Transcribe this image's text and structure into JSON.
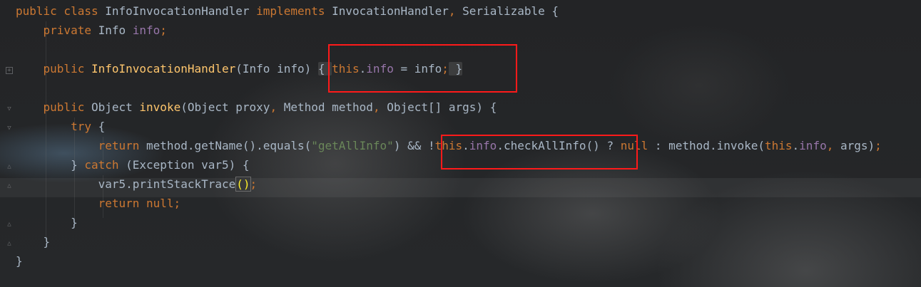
{
  "editor": {
    "lines": [
      {
        "tokens": [
          {
            "t": "public class ",
            "c": "kw"
          },
          {
            "t": "InfoInvocationHandler ",
            "c": "pl"
          },
          {
            "t": "implements ",
            "c": "kw"
          },
          {
            "t": "InvocationHandler",
            "c": "pl"
          },
          {
            "t": ", ",
            "c": "kw"
          },
          {
            "t": "Serializable {",
            "c": "pl"
          }
        ]
      },
      {
        "tokens": [
          {
            "t": "    private ",
            "c": "kw"
          },
          {
            "t": "Info ",
            "c": "pl"
          },
          {
            "t": "info",
            "c": "fld"
          },
          {
            "t": ";",
            "c": "kw"
          }
        ]
      },
      {
        "tokens": []
      },
      {
        "tokens": [
          {
            "t": "    public ",
            "c": "kw"
          },
          {
            "t": "InfoInvocationHandler",
            "c": "fn"
          },
          {
            "t": "(Info info) ",
            "c": "pl"
          },
          {
            "t": "{ ",
            "c": "pl fold-hl"
          },
          {
            "t": "this",
            "c": "kw"
          },
          {
            "t": ".",
            "c": "pl"
          },
          {
            "t": "info",
            "c": "fld"
          },
          {
            "t": " = info",
            "c": "pl"
          },
          {
            "t": ";",
            "c": "kw"
          },
          {
            "t": " }",
            "c": "pl fold-hl"
          }
        ]
      },
      {
        "tokens": []
      },
      {
        "tokens": [
          {
            "t": "    public ",
            "c": "kw"
          },
          {
            "t": "Object ",
            "c": "pl"
          },
          {
            "t": "invoke",
            "c": "fn"
          },
          {
            "t": "(Object proxy",
            "c": "pl"
          },
          {
            "t": ", ",
            "c": "kw"
          },
          {
            "t": "Method method",
            "c": "pl"
          },
          {
            "t": ", ",
            "c": "kw"
          },
          {
            "t": "Object[] args) {",
            "c": "pl"
          }
        ]
      },
      {
        "tokens": [
          {
            "t": "        try ",
            "c": "kw"
          },
          {
            "t": "{",
            "c": "pl"
          }
        ]
      },
      {
        "tokens": [
          {
            "t": "            return ",
            "c": "kw"
          },
          {
            "t": "method.getName().equals(",
            "c": "pl"
          },
          {
            "t": "\"getAllInfo\"",
            "c": "str"
          },
          {
            "t": ") && !",
            "c": "pl"
          },
          {
            "t": "this",
            "c": "kw"
          },
          {
            "t": ".",
            "c": "pl"
          },
          {
            "t": "info",
            "c": "fld"
          },
          {
            "t": ".checkAllInfo() ? ",
            "c": "pl"
          },
          {
            "t": "null ",
            "c": "kw"
          },
          {
            "t": ": method.invoke(",
            "c": "pl"
          },
          {
            "t": "this",
            "c": "kw"
          },
          {
            "t": ".",
            "c": "pl"
          },
          {
            "t": "info",
            "c": "fld"
          },
          {
            "t": ", ",
            "c": "kw"
          },
          {
            "t": "args)",
            "c": "pl"
          },
          {
            "t": ";",
            "c": "kw"
          }
        ]
      },
      {
        "tokens": [
          {
            "t": "        } ",
            "c": "pl"
          },
          {
            "t": "catch ",
            "c": "kw"
          },
          {
            "t": "(Exception var5) {",
            "c": "pl"
          }
        ]
      },
      {
        "tokens": [
          {
            "t": "            var5.printStackTrace",
            "c": "pl"
          },
          {
            "t": "CARET",
            "c": "caret"
          },
          {
            "t": "()",
            "c": "pl bracket-hl"
          },
          {
            "t": ";",
            "c": "kw"
          }
        ]
      },
      {
        "tokens": [
          {
            "t": "            return null;",
            "c": "kw"
          }
        ]
      },
      {
        "tokens": [
          {
            "t": "        }",
            "c": "pl"
          }
        ]
      },
      {
        "tokens": [
          {
            "t": "    }",
            "c": "pl"
          }
        ]
      },
      {
        "tokens": [
          {
            "t": "}",
            "c": "pl"
          }
        ]
      }
    ]
  },
  "colors": {
    "keyword": "#cc7832",
    "function": "#ffc66d",
    "field": "#9876aa",
    "string": "#6a8759",
    "plain": "#a9b7c6",
    "annotation_box": "#ff1a1a"
  },
  "gutter_icons": [
    "fold-box-icon",
    "fold-arrow-icon",
    "fold-arrow-icon",
    "fold-end-icon",
    "fold-end-icon",
    "fold-end-icon",
    "fold-end-icon"
  ]
}
